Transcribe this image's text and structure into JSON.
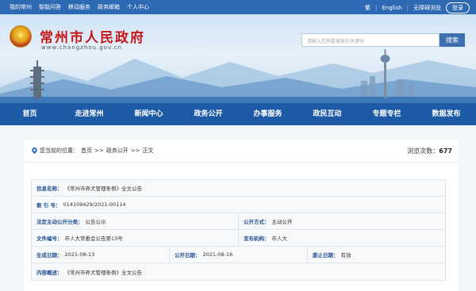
{
  "topbar": {
    "links": [
      "我的常州",
      "智能问答",
      "移动服务",
      "政务邮箱",
      "个人中心"
    ],
    "lang_simplified": "繁",
    "lang_english": "English",
    "accessibility": "无障碍浏览",
    "login": "登录"
  },
  "header": {
    "title": "常州市人民政府",
    "url": "www.changzhou.gov.cn",
    "search_placeholder": "请输入您想要搜索的关键词",
    "search_button": "搜索"
  },
  "nav": {
    "items": [
      "首页",
      "走进常州",
      "新闻中心",
      "政务公开",
      "办事服务",
      "政民互动",
      "专题专栏",
      "数据发布"
    ]
  },
  "breadcrumb": {
    "prefix": "您当前的位置：",
    "home": "首页",
    "sep1": ">>",
    "section": "政务公开",
    "sep2": ">>",
    "current": "正文"
  },
  "views": {
    "label": "浏览次数：",
    "count": "677"
  },
  "info": {
    "info_name_label": "信息名称：",
    "info_name": "《常州市养犬管理条例》全文公告",
    "index_label": "索 引 号：",
    "index": "014109429/2021-00114",
    "category_label": "法定主动公开分类：",
    "category": "公告公示",
    "disclose_method_label": "公开方式：",
    "disclose_method": "主动公开",
    "doc_no_label": "文件编号：",
    "doc_no": "市人大常委会公告第13号",
    "publisher_label": "发布机构：",
    "publisher": "市人大",
    "created_label": "生成日期：",
    "created": "2021-08-13",
    "published_label": "公开日期：",
    "published": "2021-08-16",
    "expire_label": "废止日期：",
    "expire": "有效",
    "summary_label": "内容概述：",
    "summary": "《常州市养犬管理条例》全文公告"
  },
  "colors": {
    "nav": "#1d5aa6",
    "topbar": "#2e69b3",
    "title": "#c4171a"
  },
  "icons": [
    "location-icon",
    "emblem-icon"
  ]
}
